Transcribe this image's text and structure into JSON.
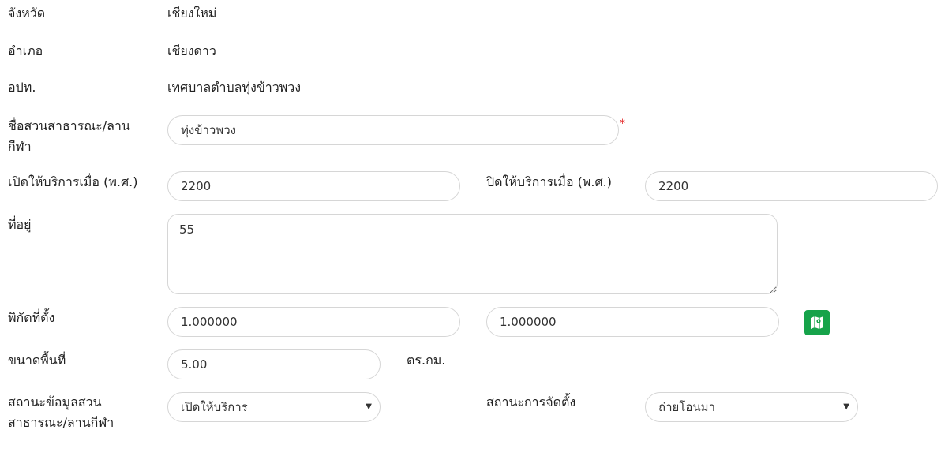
{
  "province": {
    "label": "จังหวัด",
    "value": "เชียงใหม่"
  },
  "district": {
    "label": "อำเภอ",
    "value": "เชียงดาว"
  },
  "lao": {
    "label": "อปท.",
    "value": "เทศบาลตำบลทุ่งข้าวพวง"
  },
  "park_name": {
    "label_line1": "ชื่อสวนสาธารณะ/ลาน",
    "label_line2": "กีฬา",
    "value": "ทุ่งข้าวพวง",
    "required_mark": "*"
  },
  "opened_year": {
    "label": "เปิดให้บริการเมื่อ (พ.ศ.)",
    "value": "2200"
  },
  "closed_year": {
    "label": "ปิดให้บริการเมื่อ (พ.ศ.)",
    "value": "2200"
  },
  "address": {
    "label": "ที่อยู่",
    "value": "55"
  },
  "coordinates": {
    "label": "พิกัดที่ตั้ง",
    "lat": "1.000000",
    "lng": "1.000000",
    "map_icon": "map-icon",
    "map_color": "#16a34a"
  },
  "area": {
    "label": "ขนาดพื้นที่",
    "value": "5.00",
    "unit": "ตร.กม."
  },
  "data_status": {
    "label_line1": "สถานะข้อมูลสวน",
    "label_line2": "สาธารณะ/ลานกีฬา",
    "selected": "เปิดให้บริการ"
  },
  "establish_status": {
    "label": "สถานะการจัดตั้ง",
    "selected": "ถ่ายโอนมา"
  },
  "colors": {
    "required": "#e21b1b",
    "border": "#d6d6d6"
  }
}
